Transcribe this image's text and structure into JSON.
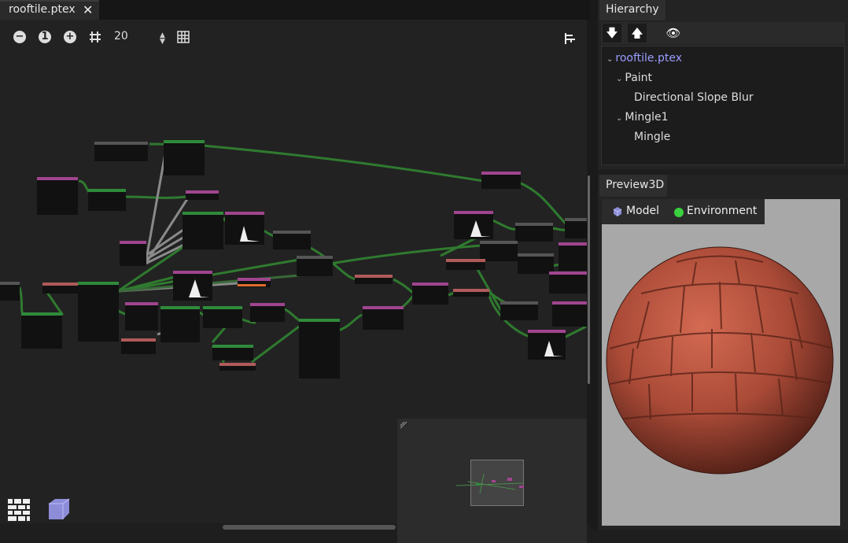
{
  "document_tab": {
    "title": "rooftile.ptex",
    "close_glyph": "✕"
  },
  "graph_toolbar": {
    "zoom_out_glyph": "−",
    "zoom_reset_glyph": "1",
    "zoom_in_glyph": "+",
    "snap_value": "20",
    "spin_up": "▲",
    "spin_down": "▼"
  },
  "hierarchy": {
    "tab_label": "Hierarchy",
    "toolbar": {
      "down_glyph": "🡇",
      "up_glyph": "🡅",
      "eye_glyph": "👁"
    },
    "items": [
      {
        "label": "rooftile.ptex",
        "expanded": true
      },
      {
        "label": "Paint",
        "expanded": true
      },
      {
        "label": "Directional Slope Blur"
      },
      {
        "label": "Mingle1",
        "expanded": true
      },
      {
        "label": "Mingle"
      }
    ],
    "expand_glyph": "⌄"
  },
  "preview": {
    "tab_label": "Preview3D",
    "model_label": "Model",
    "environment_label": "Environment"
  },
  "colors": {
    "accent": "#9a9cff",
    "wire_green": "#2f7a2f",
    "wire_gray": "#9a9a9a",
    "node_header_green": "#2f8a3a",
    "node_header_magenta": "#a0458f",
    "node_header_gray": "#555555",
    "node_header_red": "#b05a5a",
    "sphere_base": "#b34e3a"
  }
}
